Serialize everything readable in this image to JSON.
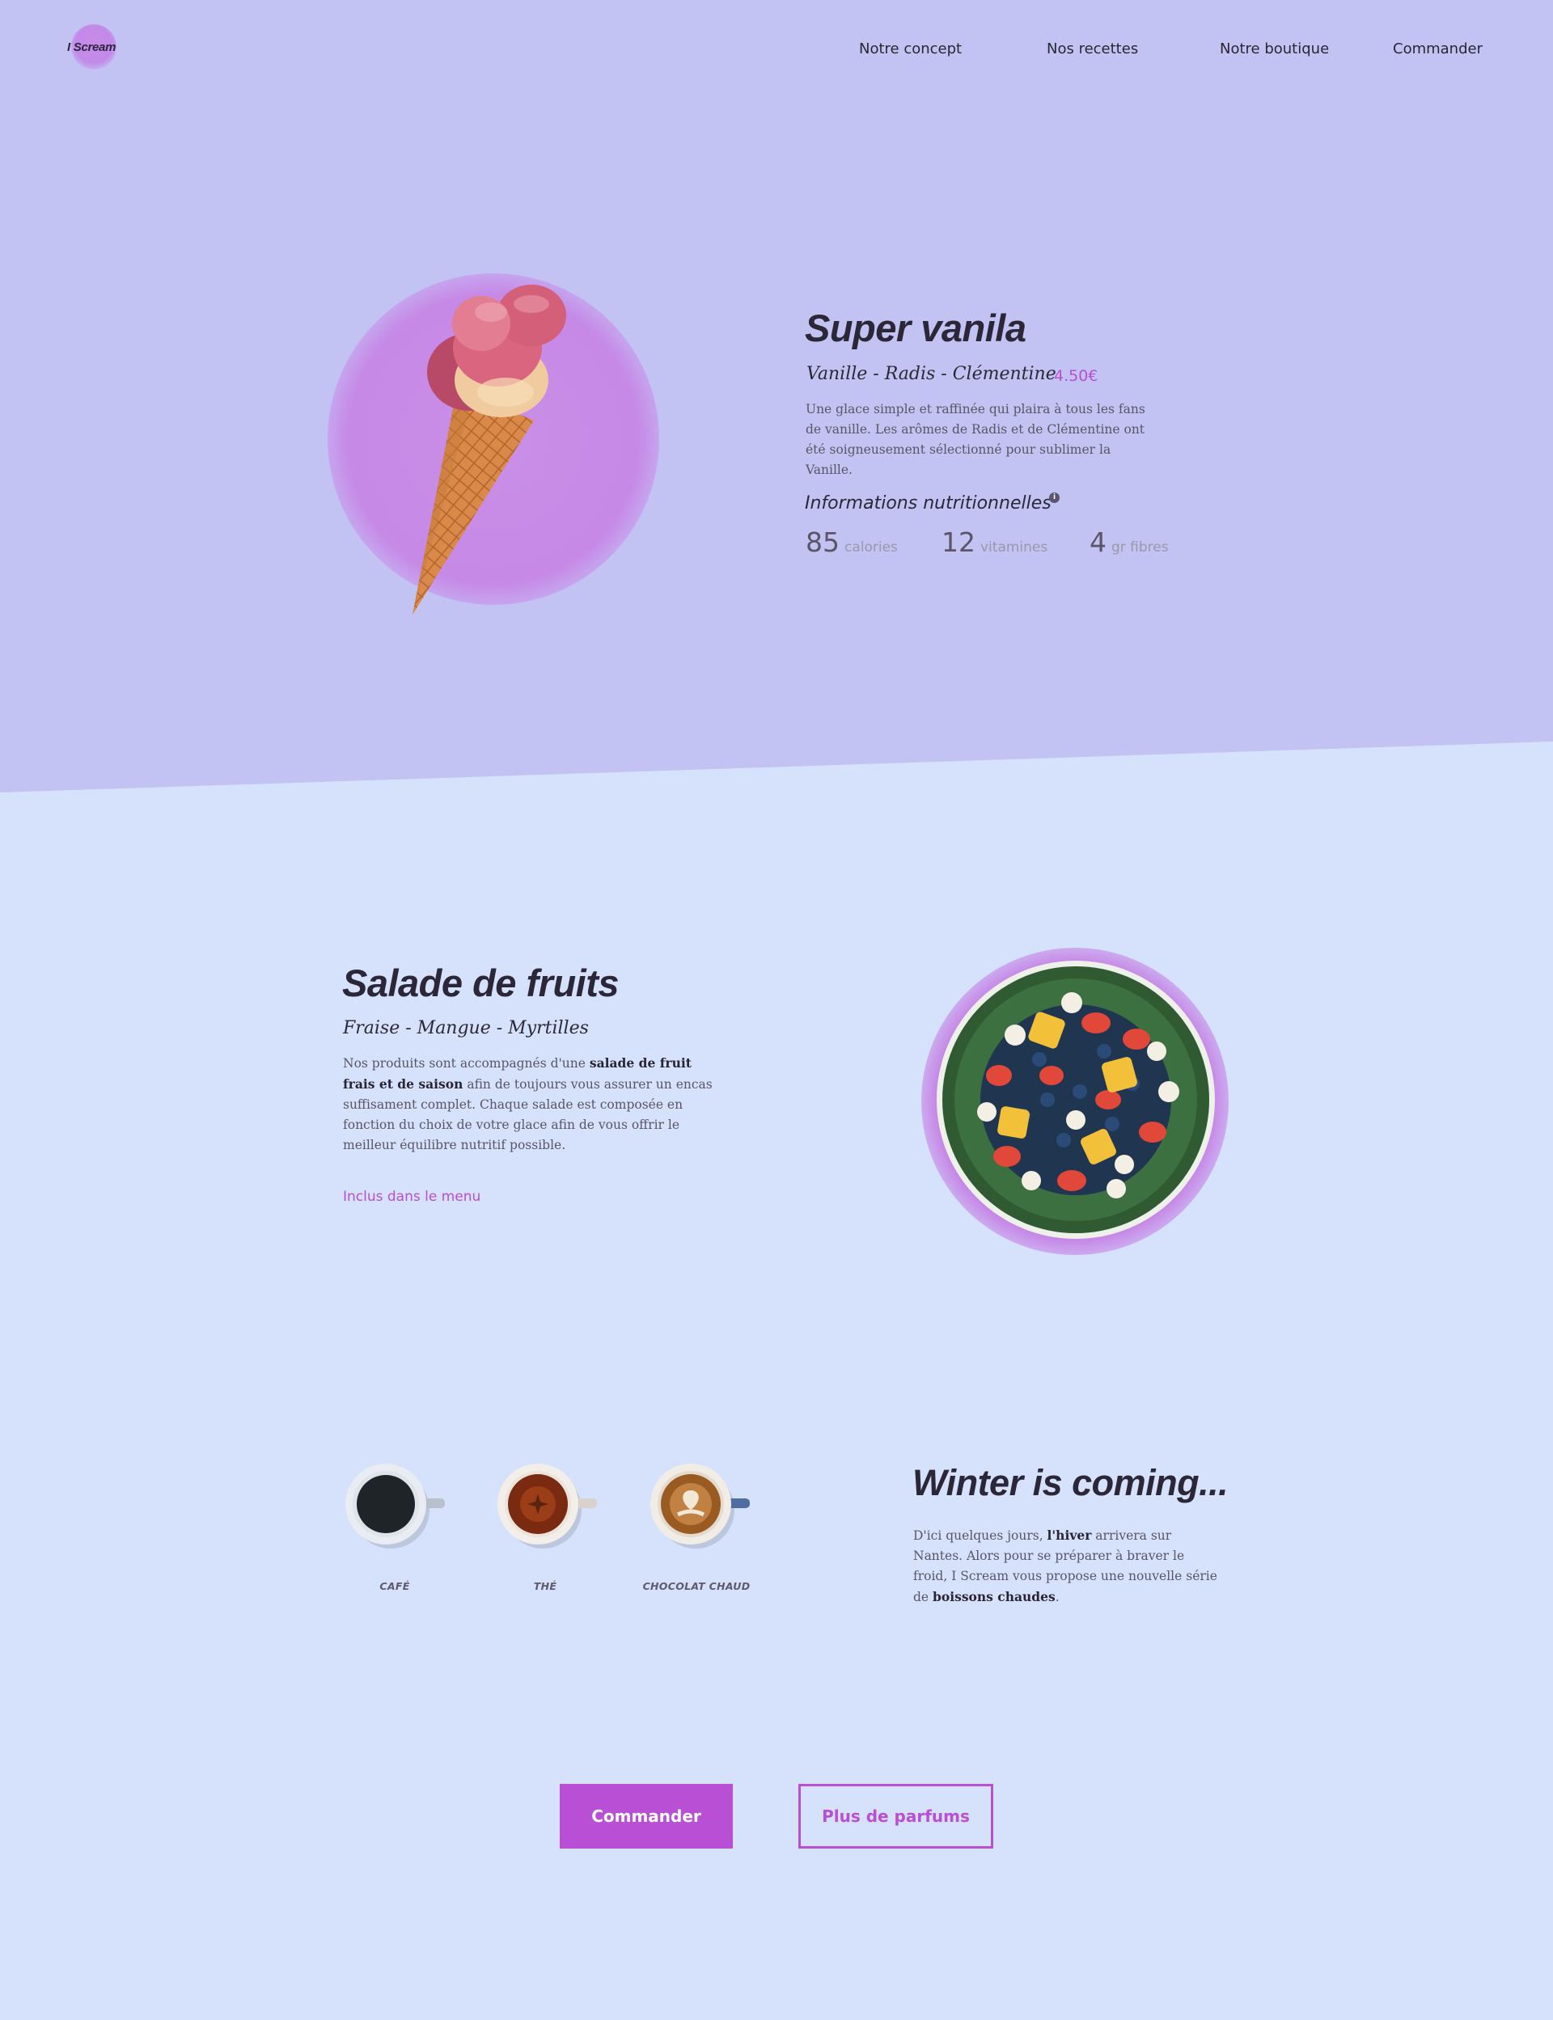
{
  "header": {
    "logo_text": "I Scream",
    "nav": [
      "Notre concept",
      "Nos recettes",
      "Notre boutique",
      "Commander"
    ]
  },
  "hero": {
    "title": "Super vanila",
    "flavors": "Vanille - Radis - Clémentine",
    "price": "4.50€",
    "description": "Une glace simple et raffinée qui plaira à tous les fans de vanille. Les arômes de Radis et de Clémentine ont été soigneusement sélectionné pour sublimer la Vanille.",
    "nutrition_title": "Informations nutritionnelles",
    "stats": [
      {
        "value": "85",
        "label": "calories"
      },
      {
        "value": "12",
        "label": "vitamines"
      },
      {
        "value": "4",
        "label": "gr fibres"
      }
    ],
    "image_icon": "ice-cream-cone"
  },
  "salad": {
    "title": "Salade de fruits",
    "fruits": "Fraise - Mangue - Myrtilles",
    "desc_a": "Nos produits sont accompagnés d'une ",
    "desc_bold": "salade de fruit frais et de saison",
    "desc_b": " afin de toujours vous assurer un encas suffisament complet. Chaque salade est composée en fonction du choix de votre glace afin de vous offrir le meilleur équilibre nutritif possible.",
    "link": "Inclus dans le menu",
    "image_icon": "fruit-salad-plate"
  },
  "winter": {
    "title": "Winter is coming...",
    "text_a": "D'ici quelques jours, ",
    "text_bold1": "l'hiver",
    "text_b": " arrivera sur Nantes. Alors pour se préparer à braver le froid, I Scream vous propose une nouvelle série de ",
    "text_bold2": "boissons chaudes",
    "text_c": ".",
    "drinks": [
      "CAFÉ",
      "THÉ",
      "CHOCOLAT CHAUD"
    ]
  },
  "cta": {
    "primary": "Commander",
    "secondary": "Plus de parfums"
  },
  "colors": {
    "hero_bg": "#c3c3f3",
    "page_bg": "#d6e2fb",
    "accent": "#b84fd4",
    "glow": "#c689e6",
    "heading": "#2b2638"
  }
}
